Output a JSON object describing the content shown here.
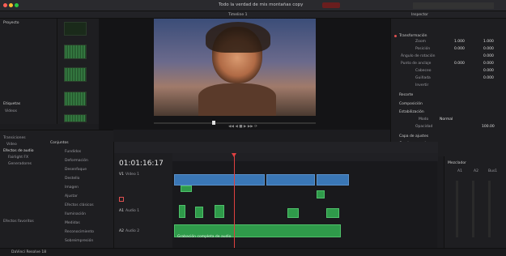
{
  "titlebar": {
    "file_title": "Todo la verdad de mis montañas copy",
    "timeline_tab": "Timeline 1"
  },
  "viewer": {
    "timecode": "01:01:16:17"
  },
  "inspector": {
    "sections": [
      "Transformación",
      "Recorte",
      "Composición",
      "Estabilización",
      "Capa de ajustes",
      "Cuadro a cuadro"
    ],
    "transform_rows": [
      {
        "label": "Zoom",
        "x": "1.000",
        "y": "1.000"
      },
      {
        "label": "Posición",
        "x": "0.000",
        "y": "0.000"
      },
      {
        "label": "Ángulo de rotación",
        "x": "0.000",
        "y": ""
      },
      {
        "label": "Punto de anclaje",
        "x": "0.000",
        "y": "0.000"
      },
      {
        "label": "Cabeceo",
        "x": "0.000",
        "y": ""
      },
      {
        "label": "Guiñada",
        "x": "0.000",
        "y": ""
      },
      {
        "label": "Invertir",
        "x": "",
        "y": ""
      }
    ],
    "composite": {
      "mode_label": "Modo",
      "mode_value": "Normal",
      "opacity_label": "Opacidad",
      "opacity_value": "100.00"
    }
  },
  "media": {
    "clips": [
      "",
      "",
      "",
      ""
    ]
  },
  "sidebar": {
    "title": "Proyecto",
    "items": [
      "Etiquetas",
      "Videos",
      "Carpeta"
    ]
  },
  "effects": {
    "title": "Conjuntos",
    "items": [
      "Fundidos",
      "Deformación",
      "Desenfoque",
      "Destello",
      "Imagen",
      "Ajustar",
      "Efectos clásicos",
      "Iluminación",
      "Medidas",
      "Reconocimiento",
      "Sobreimpresión"
    ],
    "left_items": [
      "Transiciones",
      "Vídeo",
      "Efectos de audio",
      "Fairlight FX",
      "Generadores"
    ],
    "footer": "Efectos favoritos"
  },
  "mixer": {
    "title": "Mezclador",
    "channels": [
      "A1",
      "A2",
      "Bus1"
    ]
  },
  "timeline": {
    "v1": "V1",
    "a1": "A1",
    "a2": "A2",
    "v1_name": "Vídeo 1",
    "a1_name": "Audio 1",
    "a2_name": "Audio 2",
    "long_clip": "Grabación completa de audio"
  },
  "footer": {
    "app": "DaVinci Resolve 18"
  },
  "colors": {
    "accent": "#e05050",
    "video": "#3a77b6",
    "audio": "#2f9a4a",
    "playhead": "#e04040"
  }
}
